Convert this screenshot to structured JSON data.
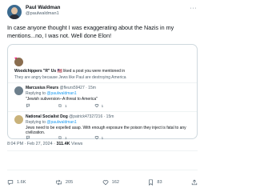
{
  "post": {
    "author_name": "Paul Waldman",
    "author_handle": "@paulwaldman1",
    "more_label": "···",
    "text": "In case anyone thought I was exaggerating about the Nazis in my mentions...no, I was not. Well done Elon!",
    "timestamp": "8:04 PM · Feb 27, 2024 · ",
    "views_count": "311.4K",
    "views_label": "Views"
  },
  "quote": {
    "liker_name": "Woodchippers \"R\" Us",
    "liker_flags": "🇺🇸",
    "liker_action": "liked a post you were mentioned in",
    "liked_text": "They are angry because Jews like Paul are destroying America",
    "replies": [
      {
        "name": "Marcusius Fleurs",
        "handle": "@fleurs59427 · 15m",
        "replying_to_prefix": "Replying to ",
        "replying_to_handle": "@paulwaldman1",
        "text": "\"Jewish subversion--A threat to America\"",
        "reply_count": "",
        "retweet_count": "1",
        "like_count": "1"
      },
      {
        "name": "National Socialist Dog",
        "handle": "@patrick47327216 · 15m",
        "replying_to_prefix": "Replying to ",
        "replying_to_handle": "@paulwaldman1",
        "text": "Jews need to be expelled asap. With enough exposure the poison they inject is fatal to any civilization.",
        "reply_count": "",
        "retweet_count": "1",
        "like_count": "1"
      }
    ]
  },
  "actions": {
    "replies": "1.6K",
    "reposts": "205",
    "likes": "162",
    "bookmarks": "83"
  },
  "colors": {
    "accent": "#1d9bf0",
    "muted": "#536471",
    "like": "#f91880",
    "border": "#cfd9de"
  },
  "icons": [
    "more-icon",
    "heart-icon",
    "reply-icon",
    "retweet-icon",
    "like-icon",
    "bookmark-icon",
    "share-icon"
  ]
}
